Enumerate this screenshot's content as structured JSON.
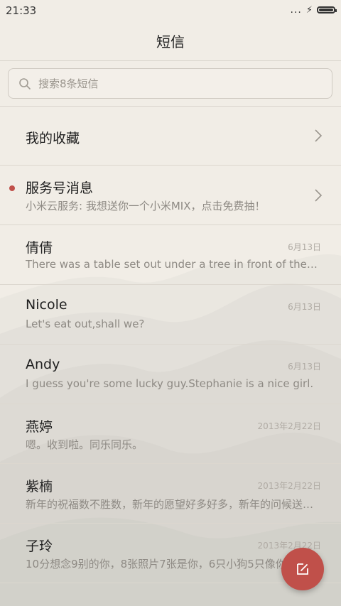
{
  "status": {
    "time": "21:33",
    "dots": "...",
    "bolt": "⚡"
  },
  "header": {
    "title": "短信"
  },
  "search": {
    "placeholder": "搜索8条短信"
  },
  "favorites": {
    "label": "我的收藏"
  },
  "conversations": [
    {
      "name": "服务号消息",
      "preview": "小米云服务: 我想送你一个小米MIX，点击免费抽！",
      "date": "",
      "unread": true
    },
    {
      "name": "倩倩",
      "preview": "There was a table set out under a tree in front of the house, and the March Hare and the Hatter were having tea at it",
      "date": "6月13日",
      "unread": false
    },
    {
      "name": "Nicole",
      "preview": "Let's eat out,shall we?",
      "date": "6月13日",
      "unread": false
    },
    {
      "name": "Andy",
      "preview": "I guess you're some lucky guy.Stephanie is a nice girl.",
      "date": "6月13日",
      "unread": false
    },
    {
      "name": "燕婷",
      "preview": "嗯。收到啦。同乐同乐。",
      "date": "2013年2月22日",
      "unread": false
    },
    {
      "name": "紫楠",
      "preview": "新年的祝福数不胜数，新年的愿望好多好多，新年的问候送给你",
      "date": "2013年2月22日",
      "unread": false
    },
    {
      "name": "子玲",
      "preview": "10分想念9别的你，8张照片7张是你，6只小狗5只像你",
      "date": "2013年2月22日",
      "unread": false
    }
  ],
  "colors": {
    "accent": "#c0504a",
    "background": "#f1ede6"
  },
  "icons": {
    "search": "search-icon",
    "chevron": "chevron-right-icon",
    "compose": "compose-icon"
  }
}
